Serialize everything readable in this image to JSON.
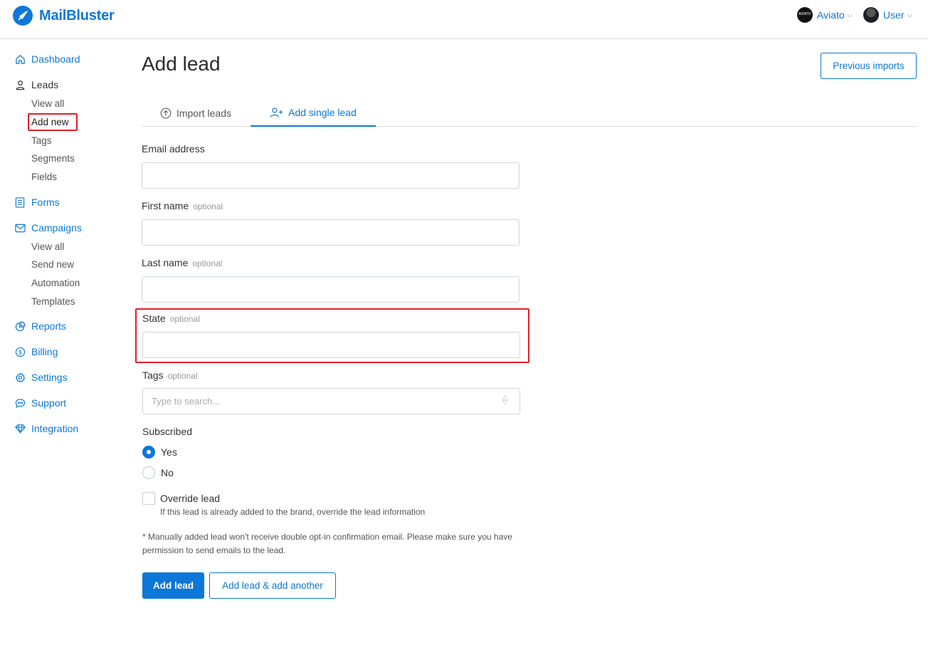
{
  "app": {
    "name": "MailBluster",
    "brand_menu": "Aviato",
    "user_menu": "User",
    "accent": "#0c77d8",
    "highlight": "#e0202a"
  },
  "sidebar": {
    "dashboard": "Dashboard",
    "leads": "Leads",
    "leads_sub": [
      "View all",
      "Add new",
      "Tags",
      "Segments",
      "Fields"
    ],
    "forms": "Forms",
    "campaigns": "Campaigns",
    "campaigns_sub": [
      "View all",
      "Send new",
      "Automation",
      "Templates"
    ],
    "reports": "Reports",
    "billing": "Billing",
    "settings": "Settings",
    "support": "Support",
    "integration": "Integration"
  },
  "page": {
    "title": "Add lead",
    "previous_imports": "Previous imports"
  },
  "tabs": {
    "import": "Import leads",
    "single": "Add single lead"
  },
  "form": {
    "email_label": "Email address",
    "first_name_label": "First name",
    "last_name_label": "Last name",
    "state_label": "State",
    "tags_label": "Tags",
    "optional": "optional",
    "tags_placeholder": "Type to search...",
    "subscribed_label": "Subscribed",
    "yes": "Yes",
    "no": "No",
    "override_label": "Override lead",
    "override_help": "If this lead is already added to the brand, override the lead information",
    "note": "* Manually added lead won't receive double opt-in confirmation email. Please make sure you have permission to send emails to the lead.",
    "add_lead": "Add lead",
    "add_another": "Add lead & add another"
  }
}
